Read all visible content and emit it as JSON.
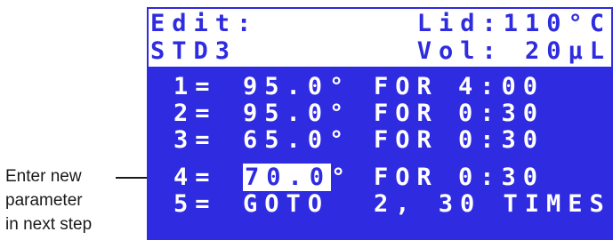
{
  "callout": {
    "lines": [
      "Enter new",
      "parameter",
      "in next step"
    ]
  },
  "lcd": {
    "header": {
      "mode": "Edit:",
      "lid": "Lid:110°C",
      "program": "STD3",
      "volume": "Vol: 20µL"
    },
    "steps": [
      {
        "num": "1=",
        "temp": "95.0°",
        "for_label": "FOR",
        "time": "4:00"
      },
      {
        "num": "2=",
        "temp": "95.0°",
        "for_label": "FOR",
        "time": "0:30"
      },
      {
        "num": "3=",
        "temp": "65.0°",
        "for_label": "FOR",
        "time": "0:30"
      },
      {
        "num": "4=",
        "temp_selected": "70.0",
        "temp_unit": "°",
        "for_label": "FOR",
        "time": "0:30"
      },
      {
        "num": "5=",
        "goto": "GOTO",
        "goto_target": "2, 30 TIMES"
      }
    ]
  },
  "colors": {
    "lcd_background": "#2e2be0",
    "lcd_text": "#ffffff"
  }
}
